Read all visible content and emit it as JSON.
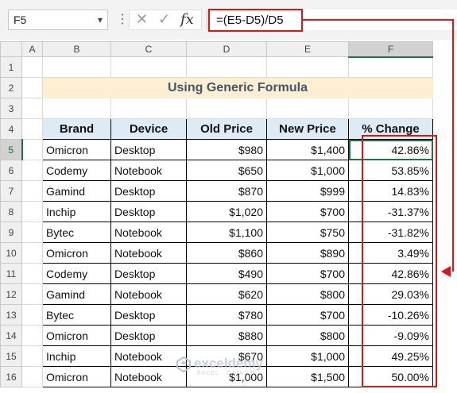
{
  "formula_bar": {
    "name_box": "F5",
    "name_box_arrow": "▾",
    "separator": "⋮",
    "cancel_icon": "✕",
    "enter_icon": "✓",
    "fx_label": "fx",
    "formula": "=(E5-D5)/D5"
  },
  "columns": [
    "A",
    "B",
    "C",
    "D",
    "E",
    "F"
  ],
  "row_numbers": [
    "1",
    "2",
    "3",
    "4",
    "5",
    "6",
    "7",
    "8",
    "9",
    "10",
    "11",
    "12",
    "13",
    "14",
    "15",
    "16"
  ],
  "title": "Using Generic Formula",
  "headers": [
    "Brand",
    "Device",
    "Old Price",
    "New Price",
    "% Change"
  ],
  "rows": [
    [
      "Omicron",
      "Desktop",
      "$980",
      "$1,400",
      "42.86%"
    ],
    [
      "Codemy",
      "Notebook",
      "$650",
      "$1,000",
      "53.85%"
    ],
    [
      "Gamind",
      "Desktop",
      "$870",
      "$999",
      "14.83%"
    ],
    [
      "Inchip",
      "Desktop",
      "$1,020",
      "$700",
      "-31.37%"
    ],
    [
      "Bytec",
      "Notebook",
      "$1,100",
      "$750",
      "-31.82%"
    ],
    [
      "Omicron",
      "Notebook",
      "$860",
      "$890",
      "3.49%"
    ],
    [
      "Codemy",
      "Desktop",
      "$490",
      "$700",
      "42.86%"
    ],
    [
      "Gamind",
      "Notebook",
      "$620",
      "$800",
      "29.03%"
    ],
    [
      "Bytec",
      "Desktop",
      "$780",
      "$700",
      "-10.26%"
    ],
    [
      "Omicron",
      "Desktop",
      "$880",
      "$800",
      "-9.09%"
    ],
    [
      "Inchip",
      "Notebook",
      "$670",
      "$1,000",
      "49.25%"
    ],
    [
      "Omicron",
      "Notebook",
      "$1,000",
      "$1,500",
      "50.00%"
    ]
  ],
  "active_cell": "F5",
  "watermark": {
    "text": "exceldemy",
    "subtext": "EXCEL · DATA · BI"
  },
  "colors": {
    "annotation": "#e01414",
    "header_fill": "#ddebf7",
    "title_fill": "#fdefd2",
    "title_text": "#44546a",
    "selection": "#217346"
  }
}
